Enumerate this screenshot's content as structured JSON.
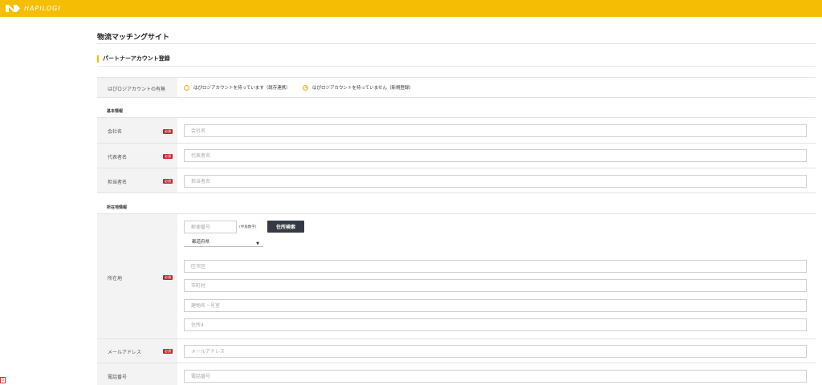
{
  "header": {
    "logo_text": "HAPILOGI",
    "logo_icon": "n-logo-icon",
    "brand_color": "#f5be05"
  },
  "page": {
    "site_title": "物流マッチングサイト",
    "section_title": "パートナーアカウント登録"
  },
  "account": {
    "label": "はぴロジアカウントの有無",
    "options": [
      {
        "label": "はぴロジアカウントを持っています（既存連携）",
        "selected": false
      },
      {
        "label": "はぴロジアカウントを持っていません（新規登録）",
        "selected": true
      }
    ]
  },
  "basic": {
    "title": "基本情報",
    "required_badge": "必須",
    "company": {
      "label": "会社名",
      "placeholder": "会社名"
    },
    "representative": {
      "label": "代表者名",
      "placeholder": "代表者名"
    },
    "contact": {
      "label": "担当者名",
      "placeholder": "担当者名"
    }
  },
  "location": {
    "title": "所在地情報",
    "label": "所在地",
    "postal_placeholder": "郵便番号",
    "postal_note": "(半角数字)",
    "search_button": "住所検索",
    "prefecture": "都道府県",
    "city_placeholder": "区市区",
    "town_placeholder": "市町村",
    "building_placeholder": "建物名・号室",
    "address4_placeholder": "住所4"
  },
  "email": {
    "label": "メールアドレス",
    "placeholder": "メールアドレス"
  },
  "phone": {
    "label": "電話番号",
    "placeholder": "電話番号"
  },
  "misc": {
    "corner_mark": "D"
  }
}
